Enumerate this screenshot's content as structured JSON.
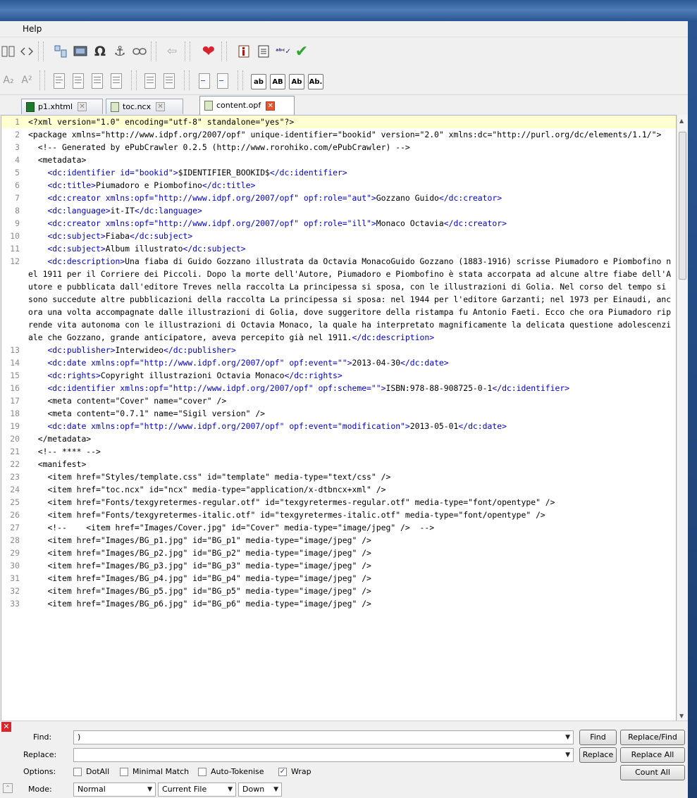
{
  "menu": {
    "help": "Help"
  },
  "toolbar_icons": {
    "row1": [
      "book-view-icon",
      "code-view-icon",
      "split-icon",
      "image-icon",
      "special-char-icon",
      "anchor-icon",
      "link-icon",
      "back-icon",
      "heart-icon",
      "metadata-icon",
      "toc-icon",
      "spellcheck-icon",
      "validate-icon"
    ],
    "row2_formats": [
      "ab",
      "AB",
      "Ab",
      "Ab."
    ]
  },
  "tabs": [
    {
      "label": "p1.xhtml",
      "icon": "xhtml-file-icon"
    },
    {
      "label": "toc.ncx",
      "icon": "ncx-file-icon"
    },
    {
      "label": "content.opf",
      "icon": "opf-file-icon",
      "active": true
    }
  ],
  "lines": [
    {
      "n": "1",
      "t": "<?xml version=\"1.0\" encoding=\"utf-8\" standalone=\"yes\"?>",
      "k": "g",
      "cur": true
    },
    {
      "n": "2",
      "t": "<package xmlns=\"http://www.idpf.org/2007/opf\" unique-identifier=\"bookid\" version=\"2.0\" xmlns:dc=\"http://purl.org/dc/elements/1.1/\">",
      "k": "g"
    },
    {
      "n": "3",
      "t": "  <!-- Generated by ePubCrawler 0.2.5 (http://www.rorohiko.com/ePubCrawler) -->",
      "k": "c"
    },
    {
      "n": "4",
      "t": "  <metadata>",
      "k": "g"
    },
    {
      "n": "5",
      "seg": [
        [
          "    <dc:identifier id=\"bookid\">",
          "g"
        ],
        [
          "$IDENTIFIER_BOOKID$",
          ""
        ],
        [
          "</dc:identifier>",
          "g"
        ]
      ]
    },
    {
      "n": "6",
      "seg": [
        [
          "    <dc:title>",
          "g"
        ],
        [
          "Piumadoro e Piombofino",
          ""
        ],
        [
          "</dc:title>",
          "g"
        ]
      ]
    },
    {
      "n": "7",
      "seg": [
        [
          "    <dc:creator xmlns:opf=\"http://www.idpf.org/2007/opf\" opf:role=\"aut\">",
          "g"
        ],
        [
          "Gozzano Guido",
          ""
        ],
        [
          "</dc:creator>",
          "g"
        ]
      ]
    },
    {
      "n": "8",
      "seg": [
        [
          "    <dc:language>",
          "g"
        ],
        [
          "it-IT",
          ""
        ],
        [
          "</dc:language>",
          "g"
        ]
      ]
    },
    {
      "n": "9",
      "seg": [
        [
          "    <dc:creator xmlns:opf=\"http://www.idpf.org/2007/opf\" opf:role=\"ill\">",
          "g"
        ],
        [
          "Monaco Octavia",
          ""
        ],
        [
          "</dc:creator>",
          "g"
        ]
      ]
    },
    {
      "n": "10",
      "seg": [
        [
          "    <dc:subject>",
          "g"
        ],
        [
          "Fiaba",
          ""
        ],
        [
          "</dc:subject>",
          "g"
        ]
      ]
    },
    {
      "n": "11",
      "seg": [
        [
          "    <dc:subject>",
          "g"
        ],
        [
          "Album illustrato",
          ""
        ],
        [
          "</dc:subject>",
          "g"
        ]
      ]
    },
    {
      "n": "12",
      "seg": [
        [
          "    <dc:description>",
          "g"
        ],
        [
          "Una fiaba di Guido Gozzano illustrata da Octavia MonacoGuido Gozzano (1883-1916) scrisse Piumadoro e Piombofino nel 1911 per il Corriere dei Piccoli. Dopo la morte dell'Autore, Piumadoro e Piombofino è stata accorpata ad alcune altre fiabe dell'Autore e pubblicata dall'editore Treves nella raccolta La principessa si sposa, con le illustrazioni di Golia. Nel corso del tempo si sono succedute altre pubblicazioni della raccolta La principessa si sposa: nel 1944 per l'editore Garzanti; nel 1973 per Einaudi, ancora una volta accompagnate dalle illustrazioni di Golia, dove suggeritore della ristampa fu Antonio Faeti. Ecco che ora Piumadoro riprende vita autonoma con le illustrazioni di Octavia Monaco, la quale ha interpretato magnificamente la delicata questione adolescenziale che Gozzano, grande anticipatore, aveva percepito già nel 1911.",
          ""
        ],
        [
          "</dc:description>",
          "g"
        ]
      ]
    },
    {
      "n": "13",
      "seg": [
        [
          "    <dc:publisher>",
          "g"
        ],
        [
          "Interwideo",
          ""
        ],
        [
          "</dc:publisher>",
          "g"
        ]
      ]
    },
    {
      "n": "14",
      "seg": [
        [
          "    <dc:date xmlns:opf=\"http://www.idpf.org/2007/opf\" opf:event=\"\">",
          "g"
        ],
        [
          "2013-04-30",
          ""
        ],
        [
          "</dc:date>",
          "g"
        ]
      ]
    },
    {
      "n": "15",
      "seg": [
        [
          "    <dc:rights>",
          "g"
        ],
        [
          "Copyright illustrazioni Octavia Monaco",
          ""
        ],
        [
          "</dc:rights>",
          "g"
        ]
      ]
    },
    {
      "n": "16",
      "seg": [
        [
          "    <dc:identifier xmlns:opf=\"http://www.idpf.org/2007/opf\" opf:scheme=\"\">",
          "g"
        ],
        [
          "ISBN:978-88-908725-0-1",
          ""
        ],
        [
          "</dc:identifier>",
          "g"
        ]
      ]
    },
    {
      "n": "17",
      "t": "    <meta content=\"Cover\" name=\"cover\" />",
      "k": "g"
    },
    {
      "n": "18",
      "t": "    <meta content=\"0.7.1\" name=\"Sigil version\" />",
      "k": "g"
    },
    {
      "n": "19",
      "seg": [
        [
          "    <dc:date xmlns:opf=\"http://www.idpf.org/2007/opf\" opf:event=\"modification\">",
          "g"
        ],
        [
          "2013-05-01",
          ""
        ],
        [
          "</dc:date>",
          "g"
        ]
      ]
    },
    {
      "n": "20",
      "t": "  </metadata>",
      "k": "g"
    },
    {
      "n": "21",
      "t": "  <!-- **** -->",
      "k": "c"
    },
    {
      "n": "22",
      "t": "  <manifest>",
      "k": "g"
    },
    {
      "n": "23",
      "t": "    <item href=\"Styles/template.css\" id=\"template\" media-type=\"text/css\" />",
      "k": "g"
    },
    {
      "n": "24",
      "t": "    <item href=\"toc.ncx\" id=\"ncx\" media-type=\"application/x-dtbncx+xml\" />",
      "k": "g"
    },
    {
      "n": "25",
      "t": "    <item href=\"Fonts/texgyretermes-regular.otf\" id=\"texgyretermes-regular.otf\" media-type=\"font/opentype\" />",
      "k": "g"
    },
    {
      "n": "26",
      "t": "    <item href=\"Fonts/texgyretermes-italic.otf\" id=\"texgyretermes-italic.otf\" media-type=\"font/opentype\" />",
      "k": "g"
    },
    {
      "n": "27",
      "t": "    <!--    <item href=\"Images/Cover.jpg\" id=\"Cover\" media-type=\"image/jpeg\" />  -->",
      "k": "c"
    },
    {
      "n": "28",
      "t": "    <item href=\"Images/BG_p1.jpg\" id=\"BG_p1\" media-type=\"image/jpeg\" />",
      "k": "g"
    },
    {
      "n": "29",
      "t": "    <item href=\"Images/BG_p2.jpg\" id=\"BG_p2\" media-type=\"image/jpeg\" />",
      "k": "g"
    },
    {
      "n": "30",
      "t": "    <item href=\"Images/BG_p3.jpg\" id=\"BG_p3\" media-type=\"image/jpeg\" />",
      "k": "g"
    },
    {
      "n": "31",
      "t": "    <item href=\"Images/BG_p4.jpg\" id=\"BG_p4\" media-type=\"image/jpeg\" />",
      "k": "g"
    },
    {
      "n": "32",
      "t": "    <item href=\"Images/BG_p5.jpg\" id=\"BG_p5\" media-type=\"image/jpeg\" />",
      "k": "g"
    },
    {
      "n": "33",
      "t": "    <item href=\"Images/BG_p6.jpg\" id=\"BG_p6\" media-type=\"image/jpeg\" />",
      "k": "g"
    }
  ],
  "find": {
    "find_label": "Find:",
    "find_value": ")",
    "replace_label": "Replace:",
    "replace_value": "",
    "find_btn": "Find",
    "replace_find_btn": "Replace/Find",
    "replace_btn": "Replace",
    "replace_all_btn": "Replace All",
    "count_all_btn": "Count All",
    "options_label": "Options:",
    "opt_dotall": "DotAll",
    "opt_minimal": "Minimal Match",
    "opt_autotok": "Auto-Tokenise",
    "opt_wrap": "Wrap",
    "wrap_checked": true,
    "mode_label": "Mode:",
    "mode_value": "Normal",
    "scope_value": "Current File",
    "direction_value": "Down"
  }
}
